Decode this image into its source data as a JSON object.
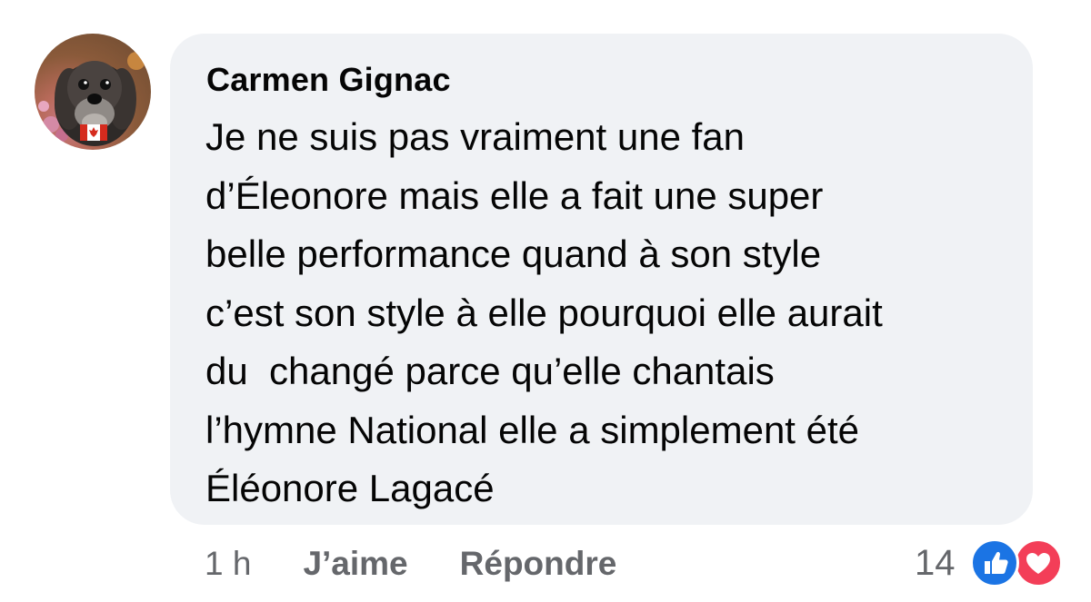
{
  "comment": {
    "author": "Carmen Gignac",
    "text_lines": [
      "Je ne suis pas vraiment une fan",
      "d’Éleonore mais elle a fait une super",
      "belle performance quand à son style",
      "c’est son style à elle pourquoi elle aurait",
      "du  changé parce qu’elle chantais",
      "l’hymne National elle a simplement été",
      "Éléonore Lagacé"
    ],
    "time": "1 h",
    "like_label": "J’aime",
    "reply_label": "Répondre",
    "reaction_count": "14",
    "reaction_icons": [
      "like-icon",
      "love-icon"
    ],
    "avatar_badge": "canada-flag-icon"
  },
  "colors": {
    "bubble_bg": "#f0f2f5",
    "meta_text": "#65676b",
    "like_blue": "#1b74e4",
    "love_red": "#f33e58"
  }
}
